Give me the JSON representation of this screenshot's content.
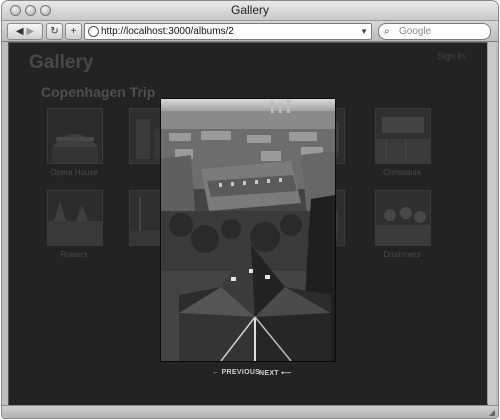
{
  "window": {
    "title": "Gallery"
  },
  "toolbar": {
    "back_icon": "back-arrow-icon",
    "forward_icon": "forward-arrow-icon",
    "reload_icon": "reload-icon",
    "add_icon": "add-bookmark-icon",
    "url": "http://localhost:3000/albums/2",
    "search_placeholder": "Google"
  },
  "page": {
    "site_title": "Gallery",
    "sign_in": "Sign In",
    "album_title": "Copenhagen Trip"
  },
  "thumbnails": [
    {
      "label": "Opera House"
    },
    {
      "label": ""
    },
    {
      "label": ""
    },
    {
      "label": "Christiania"
    },
    {
      "label": "Rowers"
    },
    {
      "label": ""
    },
    {
      "label": ""
    },
    {
      "label": "Drummers"
    }
  ],
  "lightbox": {
    "previous_label": "PREVIOUS",
    "next_label": "NEXT",
    "previous_arrow": "←",
    "next_arrow": "⟵"
  },
  "colors": {
    "page_bg": "#232323",
    "text_muted": "#4a4a4a"
  }
}
